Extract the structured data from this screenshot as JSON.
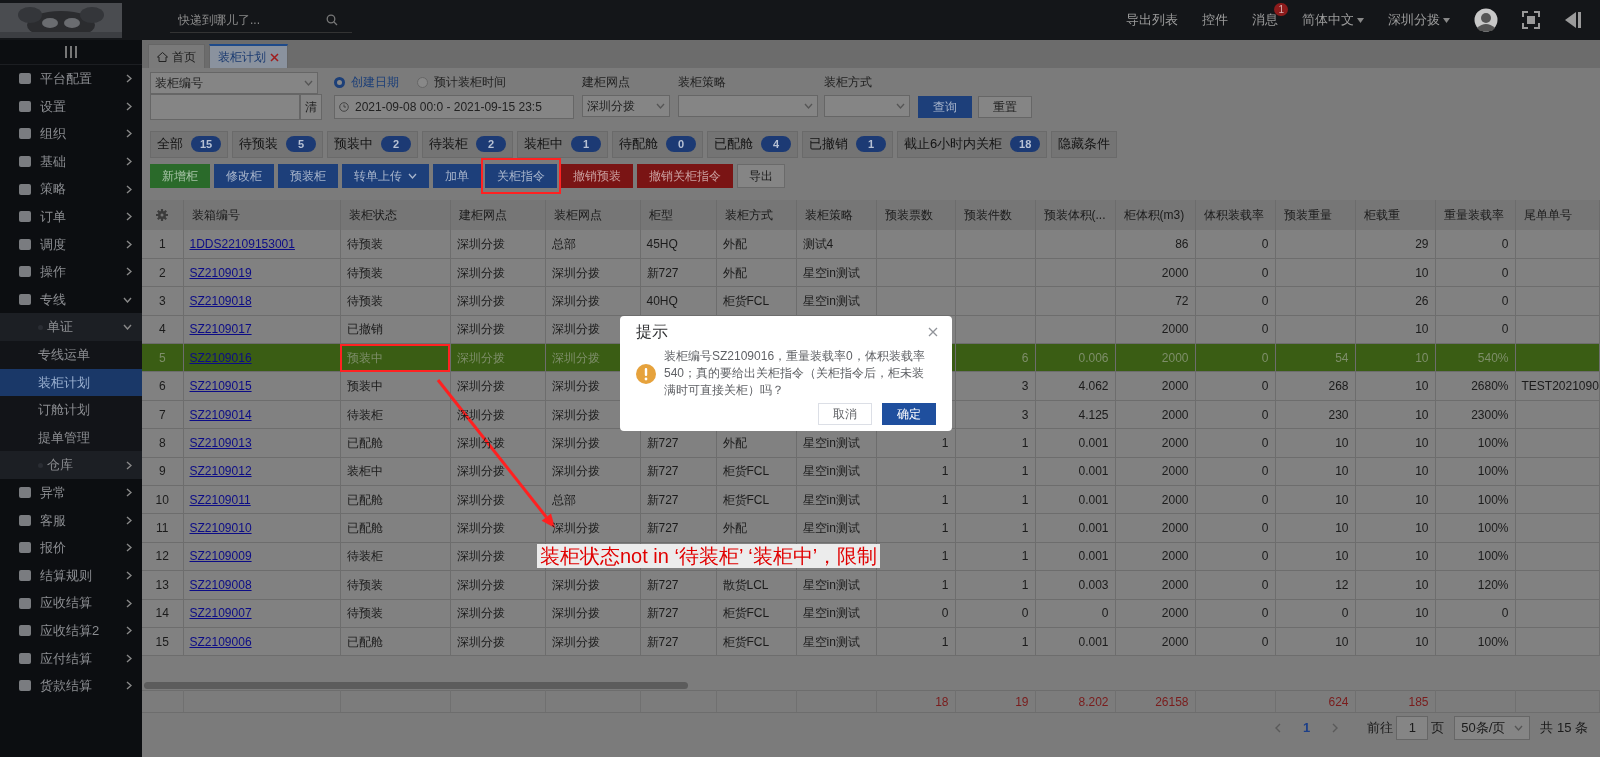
{
  "header": {
    "search_placeholder": "快递到哪儿了...",
    "links": [
      "导出列表",
      "控件"
    ],
    "messages": {
      "label": "消息",
      "badge": "1"
    },
    "dropdowns": [
      "简体中文",
      "深圳分拨"
    ]
  },
  "sidebar": {
    "items": [
      {
        "label": "平台配置",
        "expanded": false,
        "selected": false
      },
      {
        "label": "设置",
        "expanded": false,
        "selected": false
      },
      {
        "label": "组织",
        "expanded": false,
        "selected": false
      },
      {
        "label": "基础",
        "expanded": false,
        "selected": false
      },
      {
        "label": "策略",
        "expanded": false,
        "selected": false
      },
      {
        "label": "订单",
        "expanded": false,
        "selected": false
      },
      {
        "label": "调度",
        "expanded": false,
        "selected": false
      },
      {
        "label": "操作",
        "expanded": false,
        "selected": false
      },
      {
        "label": "专线",
        "expanded": true,
        "selected": false,
        "children": [
          {
            "label": "单证",
            "expanded": true,
            "selected": false,
            "children": [
              {
                "label": "专线运单",
                "selected": false
              },
              {
                "label": "装柜计划",
                "selected": true
              },
              {
                "label": "订舱计划",
                "selected": false
              },
              {
                "label": "提单管理",
                "selected": false
              }
            ]
          },
          {
            "label": "仓库",
            "expanded": false,
            "selected": false
          }
        ]
      },
      {
        "label": "异常",
        "expanded": false,
        "selected": false
      },
      {
        "label": "客服",
        "expanded": false,
        "selected": false
      },
      {
        "label": "报价",
        "expanded": false,
        "selected": false
      },
      {
        "label": "结算规则",
        "expanded": false,
        "selected": false
      },
      {
        "label": "应收结算",
        "expanded": false,
        "selected": false
      },
      {
        "label": "应收结算2",
        "expanded": false,
        "selected": false
      },
      {
        "label": "应付结算",
        "expanded": false,
        "selected": false
      },
      {
        "label": "货款结算",
        "expanded": false,
        "selected": false
      }
    ]
  },
  "tabs": [
    {
      "label": "首页",
      "selected": false,
      "closable": false
    },
    {
      "label": "装柜计划",
      "selected": true,
      "closable": true
    }
  ],
  "filters": {
    "field_select": "装柜编号",
    "clear_button": "清",
    "date_modes": [
      {
        "label": "创建日期",
        "selected": true
      },
      {
        "label": "预计装柜时间",
        "selected": false
      }
    ],
    "date_range": "2021-09-08 00:0 - 2021-09-15 23:5",
    "selects": [
      {
        "label": "建柜网点",
        "value": "深圳分拨"
      },
      {
        "label": "装柜策略"
      },
      {
        "label": "装柜方式"
      }
    ],
    "buttons": [
      {
        "label": "查询",
        "kind": "primary"
      },
      {
        "label": "重置",
        "kind": "default"
      }
    ]
  },
  "status_filters": [
    {
      "label": "全部",
      "count": "15"
    },
    {
      "label": "待预装",
      "count": "5"
    },
    {
      "label": "预装中",
      "count": "2"
    },
    {
      "label": "待装柜",
      "count": "2"
    },
    {
      "label": "装柜中",
      "count": "1"
    },
    {
      "label": "待配舱",
      "count": "0"
    },
    {
      "label": "已配舱",
      "count": "4"
    },
    {
      "label": "已撤销",
      "count": "1"
    },
    {
      "label": "截止6小时内关柜",
      "count": "18"
    },
    {
      "label": "隐藏条件"
    }
  ],
  "actions": [
    {
      "label": "新增柜",
      "kind": "success",
      "highlighted": false
    },
    {
      "label": "修改柜",
      "kind": "primary",
      "highlighted": false
    },
    {
      "label": "预装柜",
      "kind": "primary",
      "highlighted": false
    },
    {
      "label": "转单上传",
      "kind": "primary",
      "dropdown": true,
      "highlighted": false
    },
    {
      "label": "加单",
      "kind": "primary",
      "highlighted": false
    },
    {
      "label": "关柜指令",
      "kind": "primary",
      "highlighted": true
    },
    {
      "label": "撤销预装",
      "kind": "danger",
      "highlighted": false
    },
    {
      "label": "撤销关柜指令",
      "kind": "danger",
      "highlighted": false
    },
    {
      "label": "导出",
      "kind": "default",
      "highlighted": false
    }
  ],
  "table": {
    "columns": [
      "装箱编号",
      "装柜状态",
      "建柜网点",
      "装柜网点",
      "柜型",
      "装柜方式",
      "装柜策略",
      "预装票数",
      "预装件数",
      "预装体积(...",
      "柜体积(m3)",
      "体积装载率",
      "预装重量",
      "柜载重",
      "重量装载率",
      "尾单单号"
    ],
    "rows": [
      {
        "index": "1",
        "selected": false,
        "highlighted": false,
        "cells": [
          "1DDS22109153001",
          "待预装",
          "深圳分拨",
          "总部",
          "45HQ",
          "外配",
          "测试4",
          null,
          null,
          null,
          "86",
          "0",
          null,
          "29",
          "0",
          null
        ]
      },
      {
        "index": "2",
        "selected": false,
        "highlighted": false,
        "cells": [
          "SZ2109019",
          "待预装",
          "深圳分拨",
          "深圳分拨",
          "新727",
          "外配",
          "星空in测试",
          null,
          null,
          null,
          "2000",
          "0",
          null,
          "10",
          "0",
          null
        ]
      },
      {
        "index": "3",
        "selected": false,
        "highlighted": false,
        "cells": [
          "SZ2109018",
          "待预装",
          "深圳分拨",
          "深圳分拨",
          "40HQ",
          "柜货FCL",
          "星空in测试",
          null,
          null,
          null,
          "72",
          "0",
          null,
          "26",
          "0",
          null
        ]
      },
      {
        "index": "4",
        "selected": false,
        "highlighted": false,
        "cells": [
          "SZ2109017",
          "已撤销",
          "深圳分拨",
          "深圳分拨",
          null,
          null,
          null,
          null,
          null,
          null,
          "2000",
          "0",
          null,
          "10",
          "0",
          null
        ]
      },
      {
        "index": "5",
        "selected": true,
        "highlighted": true,
        "cells": [
          "SZ2109016",
          "预装中",
          "深圳分拨",
          "深圳分拨",
          null,
          null,
          null,
          null,
          "6",
          "0.006",
          "2000",
          "0",
          "54",
          "10",
          "540%",
          null
        ]
      },
      {
        "index": "6",
        "selected": false,
        "highlighted": false,
        "cells": [
          "SZ2109015",
          "预装中",
          "深圳分拨",
          "深圳分拨",
          null,
          null,
          null,
          null,
          "3",
          "4.062",
          "2000",
          "0",
          "268",
          "10",
          "2680%",
          "TEST2021090"
        ]
      },
      {
        "index": "7",
        "selected": false,
        "highlighted": false,
        "cells": [
          "SZ2109014",
          "待装柜",
          "深圳分拨",
          "深圳分拨",
          null,
          null,
          null,
          null,
          "3",
          "4.125",
          "2000",
          "0",
          "230",
          "10",
          "2300%",
          null
        ]
      },
      {
        "index": "8",
        "selected": false,
        "highlighted": false,
        "cells": [
          "SZ2109013",
          "已配舱",
          "深圳分拨",
          "深圳分拨",
          "新727",
          "外配",
          "星空in测试",
          "1",
          "1",
          "0.001",
          "2000",
          "0",
          "10",
          "10",
          "100%",
          null
        ]
      },
      {
        "index": "9",
        "selected": false,
        "highlighted": false,
        "cells": [
          "SZ2109012",
          "装柜中",
          "深圳分拨",
          "深圳分拨",
          "新727",
          "柜货FCL",
          "星空in测试",
          "1",
          "1",
          "0.001",
          "2000",
          "0",
          "10",
          "10",
          "100%",
          null
        ]
      },
      {
        "index": "10",
        "selected": false,
        "highlighted": false,
        "cells": [
          "SZ2109011",
          "已配舱",
          "深圳分拨",
          "总部",
          "新727",
          "柜货FCL",
          "星空in测试",
          "1",
          "1",
          "0.001",
          "2000",
          "0",
          "10",
          "10",
          "100%",
          null
        ]
      },
      {
        "index": "11",
        "selected": false,
        "highlighted": false,
        "cells": [
          "SZ2109010",
          "已配舱",
          "深圳分拨",
          "深圳分拨",
          "新727",
          "外配",
          "星空in测试",
          "1",
          "1",
          "0.001",
          "2000",
          "0",
          "10",
          "10",
          "100%",
          null
        ]
      },
      {
        "index": "12",
        "selected": false,
        "highlighted": false,
        "cells": [
          "SZ2109009",
          "待装柜",
          "深圳分拨",
          null,
          null,
          null,
          null,
          "1",
          "1",
          "0.001",
          "2000",
          "0",
          "10",
          "10",
          "100%",
          null
        ]
      },
      {
        "index": "13",
        "selected": false,
        "highlighted": false,
        "cells": [
          "SZ2109008",
          "待预装",
          "深圳分拨",
          "深圳分拨",
          "新727",
          "散货LCL",
          "星空in测试",
          "1",
          "1",
          "0.003",
          "2000",
          "0",
          "12",
          "10",
          "120%",
          null
        ]
      },
      {
        "index": "14",
        "selected": false,
        "highlighted": false,
        "cells": [
          "SZ2109007",
          "待预装",
          "深圳分拨",
          "深圳分拨",
          "新727",
          "柜货FCL",
          "星空in测试",
          "0",
          "0",
          "0",
          "2000",
          "0",
          "0",
          "10",
          "0",
          null
        ]
      },
      {
        "index": "15",
        "selected": false,
        "highlighted": false,
        "cells": [
          "SZ2109006",
          "已配舱",
          "深圳分拨",
          "深圳分拨",
          "新727",
          "柜货FCL",
          "星空in测试",
          "1",
          "1",
          "0.001",
          "2000",
          "0",
          "10",
          "10",
          "100%",
          null
        ]
      }
    ],
    "totals": {
      "tickets": "18",
      "pieces": "19",
      "volume": "8.202",
      "container_volume": "26158",
      "weight": "624",
      "container_weight": "185"
    }
  },
  "pagination": {
    "current": "1",
    "goto_label": "前往",
    "goto_value": "1",
    "page_label": "页",
    "page_size": "50条/页",
    "total": "共 15 条"
  },
  "dialog": {
    "title": "提示",
    "message": "装柜编号SZ2109016，重量装载率0，体积装载率540；真的要给出关柜指令（关柜指令后，柜未装满时可直接关柜）吗？",
    "buttons": [
      {
        "label": "取消",
        "kind": "default"
      },
      {
        "label": "确定",
        "kind": "primary"
      }
    ]
  },
  "annotation": {
    "note": "装柜状态not in ‘待装柜’ ‘装柜中’，限制"
  }
}
